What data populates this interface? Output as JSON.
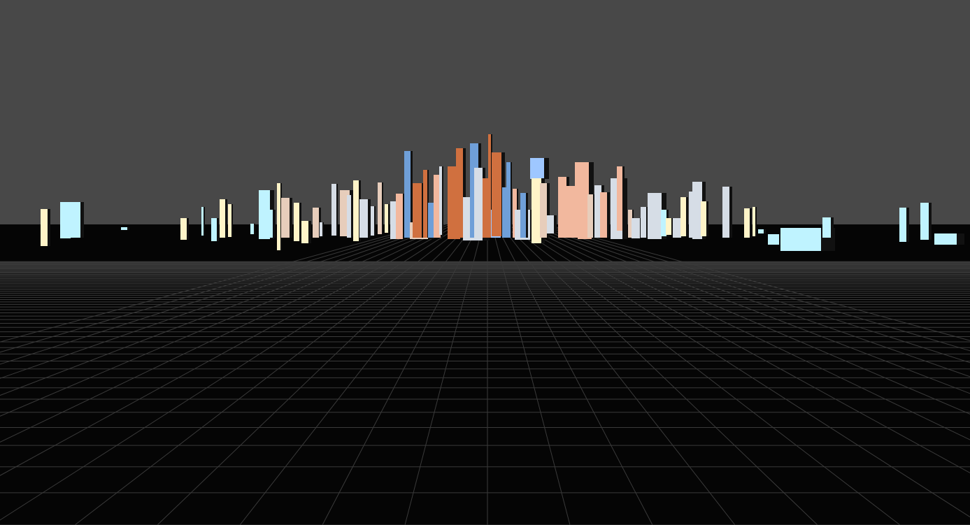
{
  "scene": {
    "colors": {
      "sky": "#484848",
      "ground": "#050505",
      "grid_line": "#3a3a3a",
      "palette": [
        "#f2b89e",
        "#d0703f",
        "#6f9fd8",
        "#d6dde6",
        "#bff3ff",
        "#fff4c8",
        "#e7cdbb",
        "#9ec7ff"
      ]
    }
  }
}
